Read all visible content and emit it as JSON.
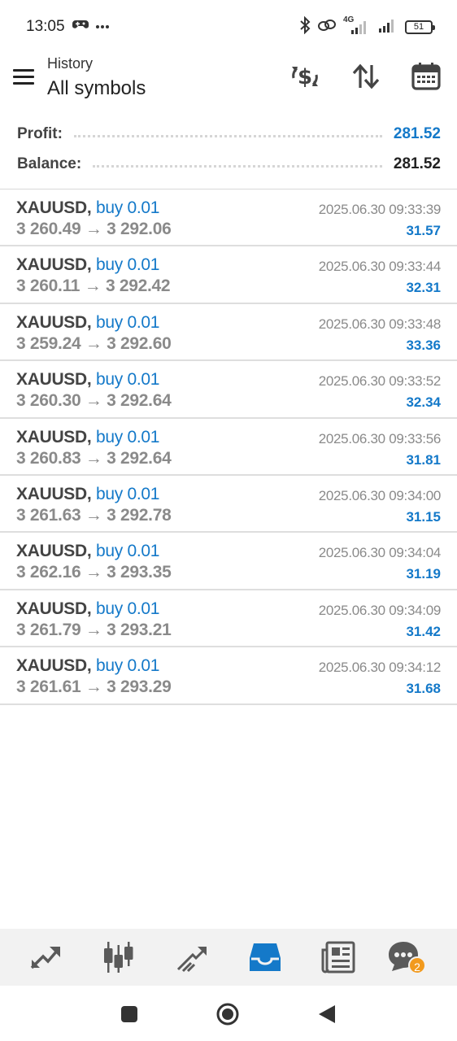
{
  "status_bar": {
    "time": "13:05",
    "left_icons": [
      "game-controller-icon",
      "more-dots-icon"
    ],
    "right_icons": [
      "bluetooth-icon",
      "link-icon",
      "signal-4g-icon",
      "signal-icon"
    ],
    "network_label": "4G",
    "battery": "51"
  },
  "header": {
    "subtitle": "History",
    "title": "All symbols",
    "actions": [
      "currency-exchange-icon",
      "sort-icon",
      "calendar-icon"
    ]
  },
  "summary": {
    "profit_label": "Profit:",
    "profit_value": "281.52",
    "balance_label": "Balance:",
    "balance_value": "281.52",
    "profit_color": "#1479c9"
  },
  "deals": [
    {
      "symbol": "XAUUSD,",
      "type": "buy 0.01",
      "prices": "3 260.49 → 3 292.06",
      "time": "2025.06.30 09:33:39",
      "profit": "31.57"
    },
    {
      "symbol": "XAUUSD,",
      "type": "buy 0.01",
      "prices": "3 260.11 → 3 292.42",
      "time": "2025.06.30 09:33:44",
      "profit": "32.31"
    },
    {
      "symbol": "XAUUSD,",
      "type": "buy 0.01",
      "prices": "3 259.24 → 3 292.60",
      "time": "2025.06.30 09:33:48",
      "profit": "33.36"
    },
    {
      "symbol": "XAUUSD,",
      "type": "buy 0.01",
      "prices": "3 260.30 → 3 292.64",
      "time": "2025.06.30 09:33:52",
      "profit": "32.34"
    },
    {
      "symbol": "XAUUSD,",
      "type": "buy 0.01",
      "prices": "3 260.83 → 3 292.64",
      "time": "2025.06.30 09:33:56",
      "profit": "31.81"
    },
    {
      "symbol": "XAUUSD,",
      "type": "buy 0.01",
      "prices": "3 261.63 → 3 292.78",
      "time": "2025.06.30 09:34:00",
      "profit": "31.15"
    },
    {
      "symbol": "XAUUSD,",
      "type": "buy 0.01",
      "prices": "3 262.16 → 3 293.35",
      "time": "2025.06.30 09:34:04",
      "profit": "31.19"
    },
    {
      "symbol": "XAUUSD,",
      "type": "buy 0.01",
      "prices": "3 261.79 → 3 293.21",
      "time": "2025.06.30 09:34:09",
      "profit": "31.42"
    },
    {
      "symbol": "XAUUSD,",
      "type": "buy 0.01",
      "prices": "3 261.61 → 3 293.29",
      "time": "2025.06.30 09:34:12",
      "profit": "31.68"
    }
  ],
  "bottom_nav": {
    "items": [
      "quotes-icon",
      "chart-icon",
      "trade-icon",
      "history-icon",
      "news-icon",
      "chat-icon"
    ],
    "active": "history-icon",
    "active_color": "#1479c9",
    "chat_badge": "2",
    "badge_color": "#f29a1e"
  },
  "system_nav": [
    "recent-apps-icon",
    "home-icon",
    "back-icon"
  ]
}
